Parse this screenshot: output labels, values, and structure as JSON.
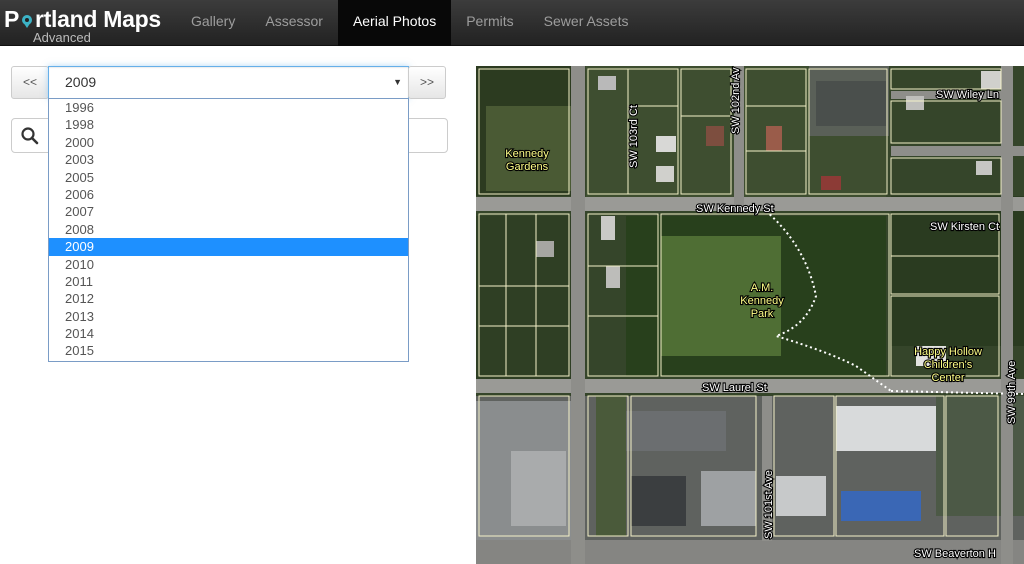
{
  "brand": {
    "title_part1": "P",
    "title_part2": "rtland Maps",
    "subtitle": "Advanced"
  },
  "nav": {
    "tabs": [
      {
        "label": "Gallery",
        "active": false
      },
      {
        "label": "Assessor",
        "active": false
      },
      {
        "label": "Aerial Photos",
        "active": true
      },
      {
        "label": "Permits",
        "active": false
      },
      {
        "label": "Sewer Assets",
        "active": false
      }
    ]
  },
  "year_selector": {
    "prev_label": "<<",
    "next_label": ">>",
    "selected": "2009",
    "options": [
      "1996",
      "1998",
      "2000",
      "2003",
      "2005",
      "2006",
      "2007",
      "2008",
      "2009",
      "2010",
      "2011",
      "2012",
      "2013",
      "2014",
      "2015"
    ]
  },
  "search": {
    "icon": "search-icon"
  },
  "map": {
    "streets": {
      "kennedy": "SW Kennedy St",
      "laurel": "SW Laurel St",
      "beaverton": "SW Beaverton H",
      "wiley": "SW Wiley Ln",
      "kirsten": "SW Kirsten Ct",
      "ave_103rd": "SW 103rd Ct",
      "ave_102nd": "SW 102nd Av",
      "ave_101st": "SW 101st Ave",
      "ave_99th": "SW 99th Ave"
    },
    "places": {
      "gardens_1": "Kennedy",
      "gardens_2": "Gardens",
      "park_1": "A.M.",
      "park_2": "Kennedy",
      "park_3": "Park",
      "center_1": "Happy Hollow",
      "center_2": "Children's",
      "center_3": "Center"
    }
  },
  "colors": {
    "navbar": "#222222",
    "active_tab": "#080808",
    "highlight": "#1e90ff",
    "focus_border": "#66afe9"
  }
}
